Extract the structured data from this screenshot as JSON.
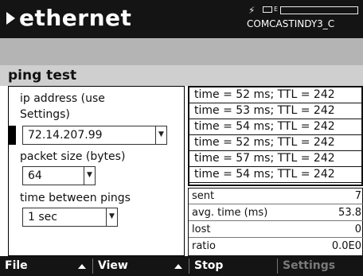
{
  "header": {
    "title": "ethernet",
    "network": "COMCASTINDY3_C",
    "battery_label": "E",
    "icons": [
      "plug-icon",
      "battery-icon",
      "signal-bar-icon"
    ]
  },
  "section": {
    "title": "ping test"
  },
  "form": {
    "ip_label_line1": "ip address (use",
    "ip_label_line2": "Settings)",
    "ip_value": "72.14.207.99",
    "packet_label": "packet size (bytes)",
    "packet_value": "64",
    "between_label": "time between pings",
    "between_value": "1 sec"
  },
  "results": [
    "time = 52 ms; TTL = 242",
    "time = 53 ms; TTL = 242",
    "time = 54 ms; TTL = 242",
    "time = 52 ms; TTL = 242",
    "time = 57 ms; TTL = 242",
    "time = 54 ms; TTL = 242"
  ],
  "stats": [
    {
      "label": "sent",
      "value": "7"
    },
    {
      "label": "avg. time (ms)",
      "value": "53.8"
    },
    {
      "label": "lost",
      "value": "0"
    },
    {
      "label": "ratio",
      "value": "0.0E0"
    }
  ],
  "toolbar": {
    "file": "File",
    "view": "View",
    "stop": "Stop",
    "settings": "Settings"
  },
  "colors": {
    "titlebar_bg": "#141414",
    "toolbar_bg": "#141414",
    "section_bg": "#cfcfcf",
    "band_bg": "#b4b4b4",
    "disabled_text": "#7a7a7a"
  }
}
